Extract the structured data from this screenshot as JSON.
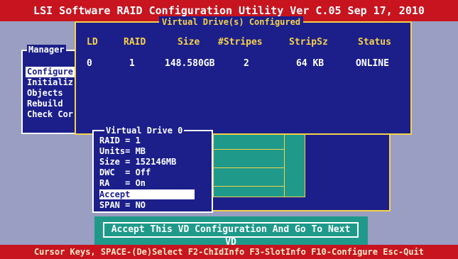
{
  "title": "LSI Software RAID Configuration Utility Ver C.05 Sep 17, 2010",
  "status_bar": "Cursor Keys, SPACE-(De)Select F2-ChIdInfo F3-SlotInfo F10-Configure Esc-Quit",
  "management_menu": {
    "title": "Manager",
    "items": [
      "Configure",
      "Initializ",
      "Objects",
      "Rebuild",
      "Check Cor"
    ],
    "selected_index": 0
  },
  "vd_table": {
    "title": "Virtual Drive(s) Configured",
    "headers": [
      "LD",
      "RAID",
      "Size",
      "#Stripes",
      "StripSz",
      "Status"
    ],
    "row": [
      "0",
      "1",
      "148.580GB",
      "2",
      "64 KB",
      "ONLINE"
    ]
  },
  "vd0_panel": {
    "title": "Virtual Drive 0",
    "lines": [
      "RAID = 1",
      "Units= MB",
      "Size = 152146MB",
      "DWC  = Off",
      "RA   = On",
      "Accept",
      "SPAN = NO"
    ],
    "selected_index": 5
  },
  "accept_banner": "Accept This VD Configuration And Go To Next VD",
  "colors": {
    "background": "#1c1f8a",
    "title_bar": "#c7141f",
    "highlight": "#f5d24a",
    "teal": "#1f9a8a",
    "gray": "#9a9ec2"
  }
}
